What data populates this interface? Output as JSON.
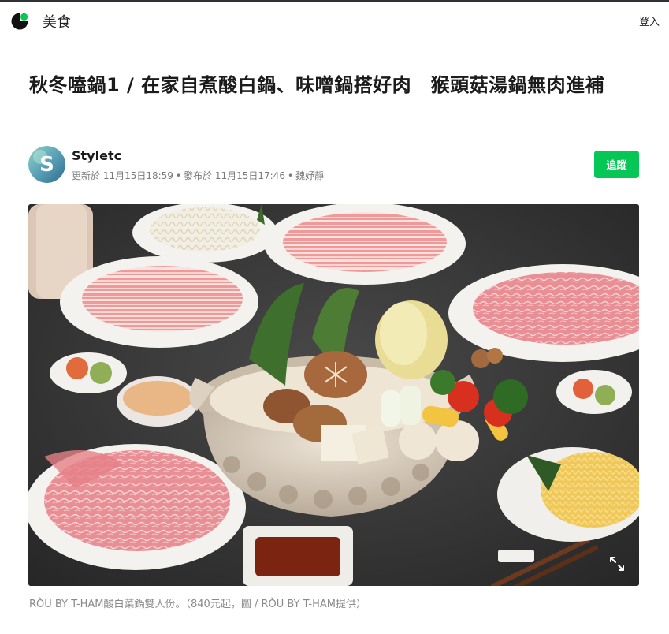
{
  "header": {
    "section_title": "美食",
    "login_label": "登入",
    "brand_color": "#06c755"
  },
  "article": {
    "title": "秋冬嗑鍋1 / 在家自煮酸白鍋、味噌鍋搭好肉　猴頭菇湯鍋無肉進補",
    "author": {
      "name": "Styletc",
      "avatar_letter": "S",
      "updated": "更新於 11月15日18:59",
      "published": "發布於 11月15日17:46",
      "editor": "魏妤靜"
    },
    "follow_label": "追蹤",
    "image_caption": "RÒU BY T-HAM酸白菜鍋雙人份。（840元起，圖 / RÒU BY T-HAM提供）"
  },
  "icons": {
    "logo": "brand-logo-icon",
    "expand": "expand-icon"
  }
}
